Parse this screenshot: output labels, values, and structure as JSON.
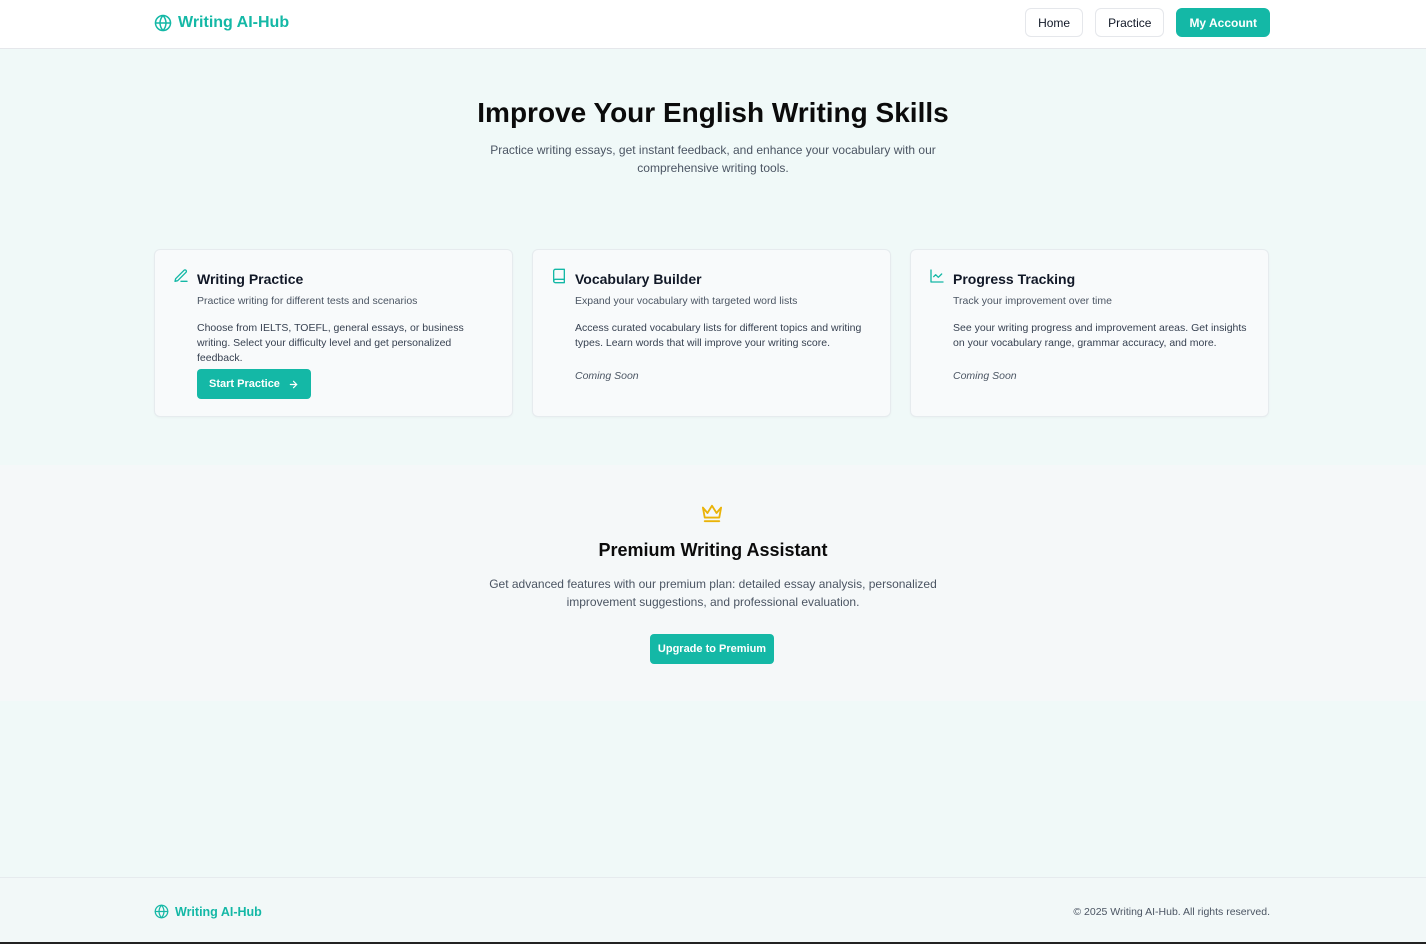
{
  "header": {
    "brand": "Writing AI-Hub",
    "nav": {
      "home": "Home",
      "practice": "Practice",
      "account": "My Account"
    }
  },
  "hero": {
    "title": "Improve Your English Writing Skills",
    "subtitle": "Practice writing essays, get instant feedback, and enhance your vocabulary with our comprehensive writing tools."
  },
  "cards": [
    {
      "icon": "pencil-icon",
      "title": "Writing Practice",
      "description": "Practice writing for different tests and scenarios",
      "body": "Choose from IELTS, TOEFL, general essays, or business writing. Select your difficulty level and get personalized feedback.",
      "button": "Start Practice"
    },
    {
      "icon": "book-icon",
      "title": "Vocabulary Builder",
      "description": "Expand your vocabulary with targeted word lists",
      "body": "Access curated vocabulary lists for different topics and writing types. Learn words that will improve your writing score.",
      "status": "Coming Soon"
    },
    {
      "icon": "line-chart-icon",
      "title": "Progress Tracking",
      "description": "Track your improvement over time",
      "body": "See your writing progress and improvement areas. Get insights on your vocabulary range, grammar accuracy, and more.",
      "status": "Coming Soon"
    }
  ],
  "premium": {
    "icon": "crown-icon",
    "title": "Premium Writing Assistant",
    "subtitle": "Get advanced features with our premium plan: detailed essay analysis, personalized improvement suggestions, and professional evaluation.",
    "button": "Upgrade to Premium"
  },
  "footer": {
    "brand": "Writing AI-Hub",
    "copyright": "© 2025 Writing AI-Hub. All rights reserved."
  },
  "colors": {
    "accent": "#14b8a6",
    "crown": "#eab308"
  }
}
